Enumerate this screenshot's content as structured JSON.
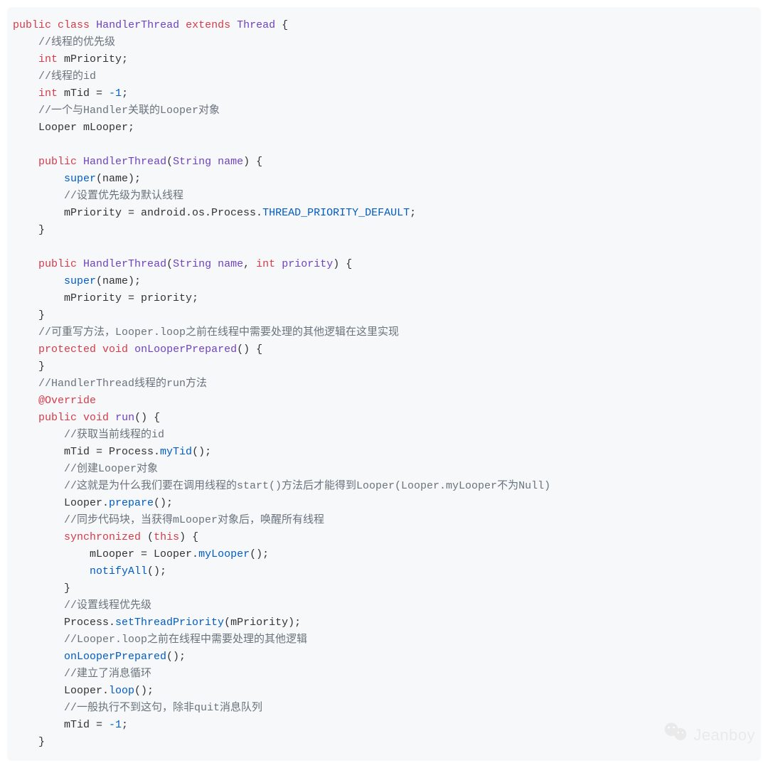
{
  "code": {
    "lines": [
      [
        [
          "kw",
          "public"
        ],
        [
          "sp",
          " "
        ],
        [
          "kw",
          "class"
        ],
        [
          "sp",
          " "
        ],
        [
          "type",
          "HandlerThread"
        ],
        [
          "sp",
          " "
        ],
        [
          "kw",
          "extends"
        ],
        [
          "sp",
          " "
        ],
        [
          "type",
          "Thread"
        ],
        [
          "txt",
          " {"
        ]
      ],
      [
        [
          "sp",
          "    "
        ],
        [
          "comm",
          "//线程的优先级"
        ]
      ],
      [
        [
          "sp",
          "    "
        ],
        [
          "kw",
          "int"
        ],
        [
          "txt",
          " mPriority;"
        ]
      ],
      [
        [
          "sp",
          "    "
        ],
        [
          "comm",
          "//线程的id"
        ]
      ],
      [
        [
          "sp",
          "    "
        ],
        [
          "kw",
          "int"
        ],
        [
          "txt",
          " mTid = "
        ],
        [
          "num",
          "-1"
        ],
        [
          "txt",
          ";"
        ]
      ],
      [
        [
          "sp",
          "    "
        ],
        [
          "comm",
          "//一个与Handler关联的Looper对象"
        ]
      ],
      [
        [
          "sp",
          "    "
        ],
        [
          "txt",
          "Looper mLooper;"
        ]
      ],
      [
        [
          "sp",
          ""
        ]
      ],
      [
        [
          "sp",
          "    "
        ],
        [
          "kw",
          "public"
        ],
        [
          "sp",
          " "
        ],
        [
          "def",
          "HandlerThread"
        ],
        [
          "txt",
          "("
        ],
        [
          "type",
          "String"
        ],
        [
          "sp",
          " "
        ],
        [
          "type",
          "name"
        ],
        [
          "txt",
          ") {"
        ]
      ],
      [
        [
          "sp",
          "        "
        ],
        [
          "func",
          "super"
        ],
        [
          "txt",
          "(name);"
        ]
      ],
      [
        [
          "sp",
          "        "
        ],
        [
          "comm",
          "//设置优先级为默认线程"
        ]
      ],
      [
        [
          "sp",
          "        "
        ],
        [
          "txt",
          "mPriority = android.os.Process."
        ],
        [
          "const",
          "THREAD_PRIORITY_DEFAULT"
        ],
        [
          "txt",
          ";"
        ]
      ],
      [
        [
          "sp",
          "    "
        ],
        [
          "txt",
          "}"
        ]
      ],
      [
        [
          "sp",
          ""
        ]
      ],
      [
        [
          "sp",
          "    "
        ],
        [
          "kw",
          "public"
        ],
        [
          "sp",
          " "
        ],
        [
          "def",
          "HandlerThread"
        ],
        [
          "txt",
          "("
        ],
        [
          "type",
          "String"
        ],
        [
          "sp",
          " "
        ],
        [
          "type",
          "name"
        ],
        [
          "txt",
          ", "
        ],
        [
          "kw",
          "int"
        ],
        [
          "sp",
          " "
        ],
        [
          "type",
          "priority"
        ],
        [
          "txt",
          ") {"
        ]
      ],
      [
        [
          "sp",
          "        "
        ],
        [
          "func",
          "super"
        ],
        [
          "txt",
          "(name);"
        ]
      ],
      [
        [
          "sp",
          "        "
        ],
        [
          "txt",
          "mPriority = priority;"
        ]
      ],
      [
        [
          "sp",
          "    "
        ],
        [
          "txt",
          "}"
        ]
      ],
      [
        [
          "sp",
          "    "
        ],
        [
          "comm",
          "//可重写方法，Looper.loop之前在线程中需要处理的其他逻辑在这里实现"
        ]
      ],
      [
        [
          "sp",
          "    "
        ],
        [
          "kw",
          "protected"
        ],
        [
          "sp",
          " "
        ],
        [
          "kw",
          "void"
        ],
        [
          "sp",
          " "
        ],
        [
          "def",
          "onLooperPrepared"
        ],
        [
          "txt",
          "() {"
        ]
      ],
      [
        [
          "sp",
          "    "
        ],
        [
          "txt",
          "}"
        ]
      ],
      [
        [
          "sp",
          "    "
        ],
        [
          "comm",
          "//HandlerThread线程的run方法"
        ]
      ],
      [
        [
          "sp",
          "    "
        ],
        [
          "ann",
          "@Override"
        ]
      ],
      [
        [
          "sp",
          "    "
        ],
        [
          "kw",
          "public"
        ],
        [
          "sp",
          " "
        ],
        [
          "kw",
          "void"
        ],
        [
          "sp",
          " "
        ],
        [
          "def",
          "run"
        ],
        [
          "txt",
          "() {"
        ]
      ],
      [
        [
          "sp",
          "        "
        ],
        [
          "comm",
          "//获取当前线程的id"
        ]
      ],
      [
        [
          "sp",
          "        "
        ],
        [
          "txt",
          "mTid = Process."
        ],
        [
          "func",
          "myTid"
        ],
        [
          "txt",
          "();"
        ]
      ],
      [
        [
          "sp",
          "        "
        ],
        [
          "comm",
          "//创建Looper对象"
        ]
      ],
      [
        [
          "sp",
          "        "
        ],
        [
          "comm",
          "//这就是为什么我们要在调用线程的start()方法后才能得到Looper(Looper.myLooper不为Null)"
        ]
      ],
      [
        [
          "sp",
          "        "
        ],
        [
          "txt",
          "Looper."
        ],
        [
          "func",
          "prepare"
        ],
        [
          "txt",
          "();"
        ]
      ],
      [
        [
          "sp",
          "        "
        ],
        [
          "comm",
          "//同步代码块，当获得mLooper对象后，唤醒所有线程"
        ]
      ],
      [
        [
          "sp",
          "        "
        ],
        [
          "kw",
          "synchronized"
        ],
        [
          "txt",
          " ("
        ],
        [
          "kw",
          "this"
        ],
        [
          "txt",
          ") {"
        ]
      ],
      [
        [
          "sp",
          "            "
        ],
        [
          "txt",
          "mLooper = Looper."
        ],
        [
          "func",
          "myLooper"
        ],
        [
          "txt",
          "();"
        ]
      ],
      [
        [
          "sp",
          "            "
        ],
        [
          "func",
          "notifyAll"
        ],
        [
          "txt",
          "();"
        ]
      ],
      [
        [
          "sp",
          "        "
        ],
        [
          "txt",
          "}"
        ]
      ],
      [
        [
          "sp",
          "        "
        ],
        [
          "comm",
          "//设置线程优先级"
        ]
      ],
      [
        [
          "sp",
          "        "
        ],
        [
          "txt",
          "Process."
        ],
        [
          "func",
          "setThreadPriority"
        ],
        [
          "txt",
          "(mPriority);"
        ]
      ],
      [
        [
          "sp",
          "        "
        ],
        [
          "comm",
          "//Looper.loop之前在线程中需要处理的其他逻辑"
        ]
      ],
      [
        [
          "sp",
          "        "
        ],
        [
          "func",
          "onLooperPrepared"
        ],
        [
          "txt",
          "();"
        ]
      ],
      [
        [
          "sp",
          "        "
        ],
        [
          "comm",
          "//建立了消息循环"
        ]
      ],
      [
        [
          "sp",
          "        "
        ],
        [
          "txt",
          "Looper."
        ],
        [
          "func",
          "loop"
        ],
        [
          "txt",
          "();"
        ]
      ],
      [
        [
          "sp",
          "        "
        ],
        [
          "comm",
          "//一般执行不到这句，除非quit消息队列"
        ]
      ],
      [
        [
          "sp",
          "        "
        ],
        [
          "txt",
          "mTid = "
        ],
        [
          "num",
          "-1"
        ],
        [
          "txt",
          ";"
        ]
      ],
      [
        [
          "sp",
          "    "
        ],
        [
          "txt",
          "}"
        ]
      ]
    ]
  },
  "watermark": {
    "text": "Jeanboy"
  }
}
